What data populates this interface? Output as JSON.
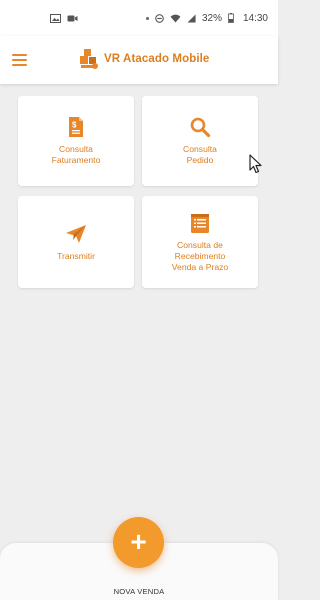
{
  "status_bar": {
    "battery": "32%",
    "time": "14:30",
    "icons": [
      "image-icon",
      "video-icon",
      "dnd-icon",
      "wifi-icon",
      "signal-icon",
      "battery-icon"
    ]
  },
  "app_bar": {
    "title": "VR Atacado Mobile",
    "menu_icon": "hamburger-menu-icon",
    "logo_icon": "boxes-logo-icon"
  },
  "cards": [
    {
      "label": "Consulta\nFaturamento",
      "icon": "invoice-dollar-icon"
    },
    {
      "label": "Consulta\nPedido",
      "icon": "search-icon"
    },
    {
      "label": "Transmitir",
      "icon": "paper-plane-icon"
    },
    {
      "label": "Consulta de\nRecebimento\nVenda a Prazo",
      "icon": "receipt-list-icon"
    }
  ],
  "fab": {
    "symbol": "+",
    "label": "NOVA VENDA"
  },
  "colors": {
    "accent": "#e07d1e",
    "fab": "#f29a2b",
    "background": "#eeeeee",
    "card": "#ffffff"
  }
}
